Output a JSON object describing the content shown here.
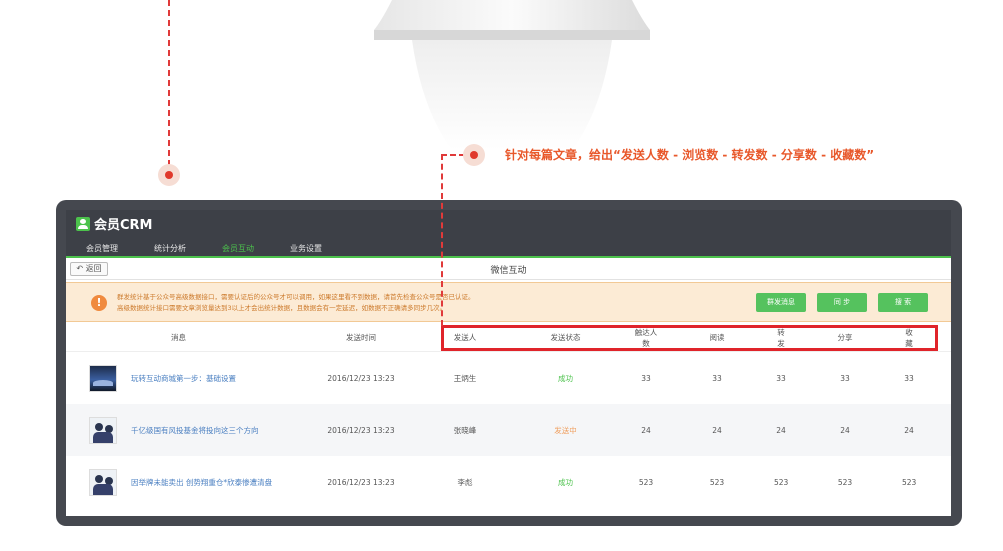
{
  "callout": {
    "text": "针对每篇文章，给出“发送人数 - 浏览数 - 转发数 - 分享数 - 收藏数”"
  },
  "app": {
    "title": "会员CRM",
    "nav": [
      "会员管理",
      "统计分析",
      "会员互动",
      "业务设置"
    ],
    "active_nav": "会员互动"
  },
  "toolbar": {
    "back_label": "返回",
    "page_title": "微信互动"
  },
  "notice": {
    "icon": "exclamation-icon",
    "line1": "群发统计基于公众号高级数据接口，需要认证后的公众号才可以调用，如果这里看不到数据，请首先检查公众号是否已认证。",
    "line2": "高级数据统计接口需要文章浏览量达到3以上才会出统计数据，且数据会有一定延迟，如数据不正确请多同步几次。"
  },
  "buttons": {
    "mass_send": "群发消息",
    "sync": "同 步",
    "search": "搜 索"
  },
  "table": {
    "headers": [
      "消息",
      "发送时间",
      "发送人",
      "发送状态",
      "触达人数",
      "阅读",
      "转发",
      "分享",
      "收藏"
    ],
    "rows": [
      {
        "thumb": "night-building",
        "title": "玩转互动商城第一步：基础设置",
        "time": "2016/12/23  13:23",
        "sender": "王炳生",
        "status": "成功",
        "reach": "33",
        "read": "33",
        "forward": "33",
        "share": "33",
        "favorite": "33"
      },
      {
        "thumb": "people",
        "title": "千亿级国有风投基金将投向这三个方向",
        "time": "2016/12/23  13:23",
        "sender": "张晓峰",
        "status": "发送中",
        "reach": "24",
        "read": "24",
        "forward": "24",
        "share": "24",
        "favorite": "24"
      },
      {
        "thumb": "people",
        "title": "因举牌未能卖出 创势翔重仓*欣泰惨遭清盘",
        "time": "2016/12/23  13:23",
        "sender": "李彪",
        "status": "成功",
        "reach": "523",
        "read": "523",
        "forward": "523",
        "share": "523",
        "favorite": "523"
      }
    ]
  },
  "colors": {
    "accent_green": "#4cc24c",
    "highlight_red": "#e0242a",
    "callout_orange": "#e8582b",
    "link_blue": "#4a7fc1"
  }
}
